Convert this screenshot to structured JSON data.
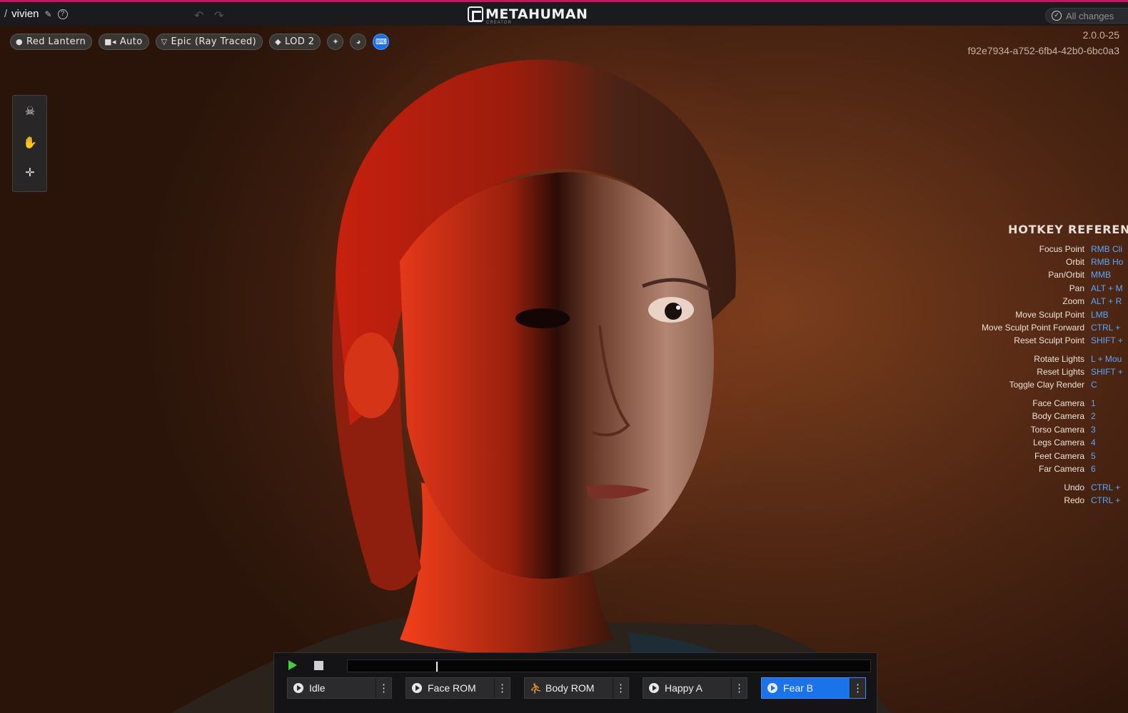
{
  "topbar": {
    "project_name": "vivien",
    "logo_text": "METAHUMAN",
    "logo_sub": "CREATOR",
    "changes_status": "All changes"
  },
  "viewport": {
    "toolbar": {
      "lighting": "Red Lantern",
      "camera": "Auto",
      "quality": "Epic (Ray Traced)",
      "lod": "LOD 2"
    },
    "version": "2.0.0-25",
    "build_id": "f92e7934-a752-6fb4-42b0-6bc0a3"
  },
  "hotkeys": {
    "title": "HOTKEY REFERENC",
    "rows": [
      {
        "label": "Focus Point",
        "key": "RMB Cli"
      },
      {
        "label": "Orbit",
        "key": "RMB Ho"
      },
      {
        "label": "Pan/Orbit",
        "key": "MMB"
      },
      {
        "label": "Pan",
        "key": "ALT + M"
      },
      {
        "label": "Zoom",
        "key": "ALT + R"
      },
      {
        "label": "Move Sculpt Point",
        "key": "LMB"
      },
      {
        "label": "Move Sculpt Point Forward",
        "key": "CTRL +"
      },
      {
        "label": "Reset Sculpt Point",
        "key": "SHIFT +"
      },
      {
        "label": "Rotate Lights",
        "key": "L + Mou"
      },
      {
        "label": "Reset Lights",
        "key": "SHIFT +"
      },
      {
        "label": "Toggle Clay Render",
        "key": "C"
      },
      {
        "label": "Face Camera",
        "key": "1"
      },
      {
        "label": "Body Camera",
        "key": "2"
      },
      {
        "label": "Torso Camera",
        "key": "3"
      },
      {
        "label": "Legs Camera",
        "key": "4"
      },
      {
        "label": "Feet Camera",
        "key": "5"
      },
      {
        "label": "Far Camera",
        "key": "6"
      },
      {
        "label": "Undo",
        "key": "CTRL +"
      },
      {
        "label": "Redo",
        "key": "CTRL +"
      }
    ]
  },
  "animation": {
    "progress": 0.17,
    "clips": [
      {
        "label": "Idle",
        "icon": "play-circle-icon"
      },
      {
        "label": "Face ROM",
        "icon": "play-circle-icon"
      },
      {
        "label": "Body ROM",
        "icon": "running-figure-icon"
      },
      {
        "label": "Happy A",
        "icon": "play-circle-icon"
      },
      {
        "label": "Fear B",
        "icon": "play-circle-icon",
        "active": true
      }
    ]
  },
  "colors": {
    "accent": "#1a73e8",
    "hotkey_key": "#54a8ff",
    "top_border": "#c2185b",
    "play": "#3fcf3f"
  }
}
